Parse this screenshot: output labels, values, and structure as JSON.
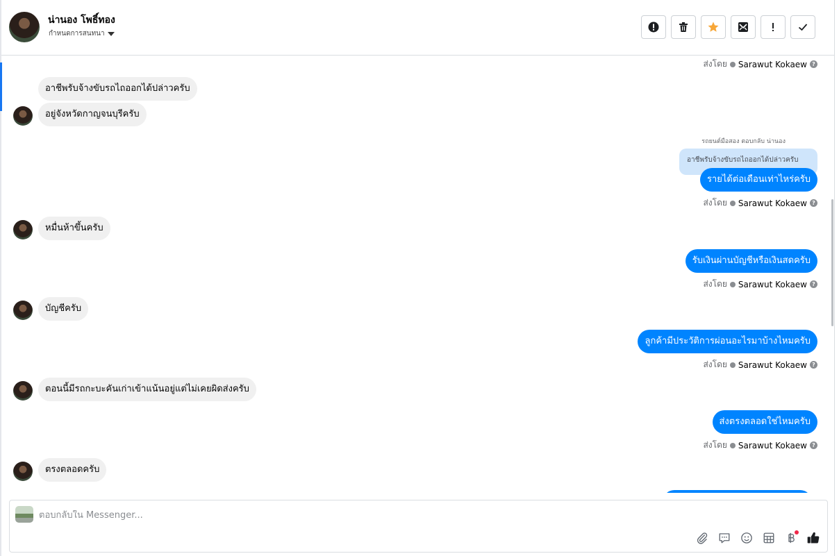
{
  "contact": {
    "name": "น่านอง โพธิ์ทอง",
    "status_label": "กำหนดการสนทนา"
  },
  "toolbar": {
    "buttons": [
      "report-spam",
      "delete",
      "star",
      "mark-unread",
      "important",
      "done"
    ],
    "star_color": "#f7a637"
  },
  "sent_by": {
    "prefix": "ส่งโดย",
    "name": "Sarawut Kokaew"
  },
  "messages": [
    {
      "side": "in",
      "text": "อาชีพรับจ้างขับรถไถออกได้ปล่าวครับ"
    },
    {
      "side": "in",
      "text": "อยู่จังหวัดกาญจนบุรีครับ"
    },
    {
      "side": "out",
      "text": "รายได้ต่อเดือนเท่าไหร่ครับ"
    },
    {
      "side": "in",
      "text": "หมื่นห้าขึ้นครับ"
    },
    {
      "side": "out",
      "text": "รับเงินผ่านบัญชีหรือเงินสดครับ"
    },
    {
      "side": "in",
      "text": "บัญชีครับ"
    },
    {
      "side": "out",
      "text": "ลูกค้ามีประวัติการผ่อนอะไรมาบ้างไหมครับ"
    },
    {
      "side": "in",
      "text": "ตอนนี้มีรถกะบะคันเก่าเข้าแน้นอยู่แต่ไม่เคยผิดส่งครับ"
    },
    {
      "side": "out",
      "text": "ส่งตรงตลอดใช่ไหมครับ"
    },
    {
      "side": "in",
      "text": "ตรงตลอดครับ"
    }
  ],
  "reply": {
    "label": "รถยนต์มือสอง ตอบกลับ น่านอง",
    "quote": "อาชีพรับจ้างขับรถไถออกได้ปล่าวครับ"
  },
  "composer": {
    "placeholder": "ตอบกลับใน Messenger..."
  },
  "colors": {
    "outgoing": "#0084ff",
    "incoming": "#f0f0f0",
    "accent": "#1877f2"
  }
}
